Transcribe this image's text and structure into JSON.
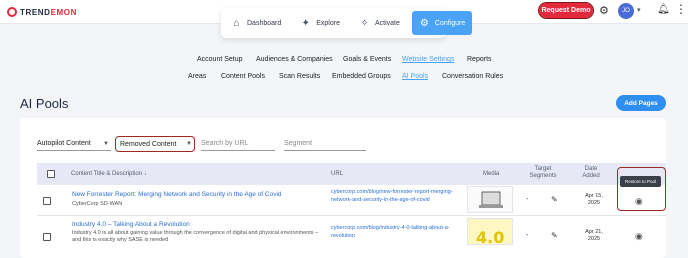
{
  "app": {
    "logo_prefix": "TREND",
    "logo_suffix": "EMON",
    "request_demo": "Request Demo",
    "avatar_initials": "JO"
  },
  "top_nav": [
    {
      "label": "Dashboard",
      "icon": "house-icon",
      "active": false
    },
    {
      "label": "Explore",
      "icon": "compass-icon",
      "active": false
    },
    {
      "label": "Activate",
      "icon": "sparkle-icon",
      "active": false
    },
    {
      "label": "Configure",
      "icon": "gear-icon",
      "active": true
    }
  ],
  "sub_nav_row1": [
    "Account Setup",
    "Audiences & Companies",
    "Goals & Events",
    "Website Settings",
    "Reports"
  ],
  "sub_nav_row2": [
    "Areas",
    "Content Pools",
    "Scan Results",
    "Embedded Groups",
    "AI Pools",
    "Conversation Rules"
  ],
  "page": {
    "title": "AI Pools",
    "add_button": "Add Pages"
  },
  "filters": {
    "type_select": "Autopilot Content",
    "status_select": "Removed Content",
    "search_placeholder": "Search by URL",
    "segment_placeholder": "Segment"
  },
  "table": {
    "headers": {
      "title": "Content Title & Description",
      "url": "URL",
      "media": "Media",
      "target": "Target Segments",
      "date": "Date Added"
    },
    "rows": [
      {
        "title": "New Forrester Report: Merging Network and Security in the Age of Covid",
        "description": "CyberCorp SD-WAN",
        "url": "cybercorp.com/blog/new-forrester-report-merging-network-and-security-in-the-age-of-covid",
        "segments": "-",
        "date": "Apr 15, 2025"
      },
      {
        "title": "Industry 4.0 – Talking About a Revolution",
        "description": "Industry 4.0 is all about gaining value through the convergence of digital and physical environments – and this is exactly why SASE is needed",
        "url": "cybercorp.com/blog/industry-4-0-talking-about-a-revolution",
        "segments": "-",
        "date": "Apr 21, 2025"
      }
    ],
    "tooltip": "Restore to Pool"
  },
  "colors": {
    "accent": "#4aa3f5",
    "brand_red": "#e4293b",
    "highlight": "#9b2a24"
  }
}
